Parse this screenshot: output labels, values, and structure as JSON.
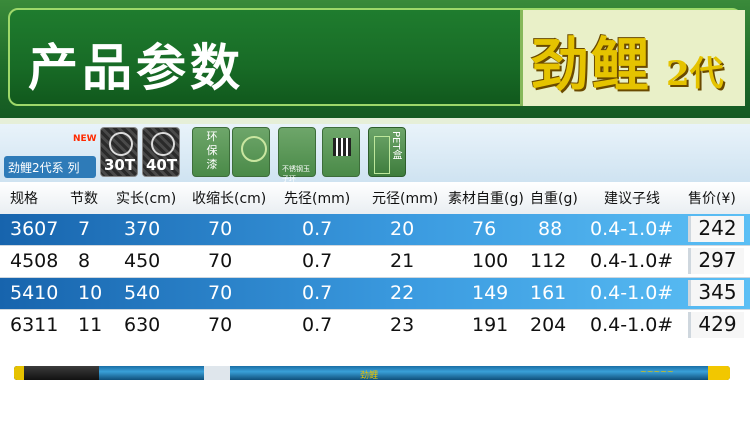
{
  "banner": {
    "title": "产品参数",
    "brand_main": "劲鲤",
    "brand_sub": "2代"
  },
  "features": {
    "new_tag": "NEW",
    "series_label": "劲鲤2代系 列",
    "carbon_30": "30T",
    "carbon_40": "40T",
    "eco_paint": "环\n保\n漆",
    "ring_label": "不锈钢玉子环",
    "pet_label": "PET盒"
  },
  "table": {
    "headers": [
      "规格",
      "节数",
      "实长(cm)",
      "收缩长(cm)",
      "先径(mm)",
      "元径(mm)",
      "素材自重(g)",
      "自重(g)",
      "建议子线",
      "售价(¥)"
    ],
    "rows": [
      [
        "3607",
        "7",
        "370",
        "70",
        "0.7",
        "20",
        "76",
        "88",
        "0.4-1.0#",
        "242"
      ],
      [
        "4508",
        "8",
        "450",
        "70",
        "0.7",
        "21",
        "100",
        "112",
        "0.4-1.0#",
        "297"
      ],
      [
        "5410",
        "10",
        "540",
        "70",
        "0.7",
        "22",
        "149",
        "161",
        "0.4-1.0#",
        "345"
      ],
      [
        "6311",
        "11",
        "630",
        "70",
        "0.7",
        "23",
        "191",
        "204",
        "0.4-1.0#",
        "429"
      ]
    ]
  },
  "colors": {
    "banner_green": "#1f7c2e",
    "brand_yellow": "#e5c300",
    "row_blue": "#2e8ad0"
  }
}
